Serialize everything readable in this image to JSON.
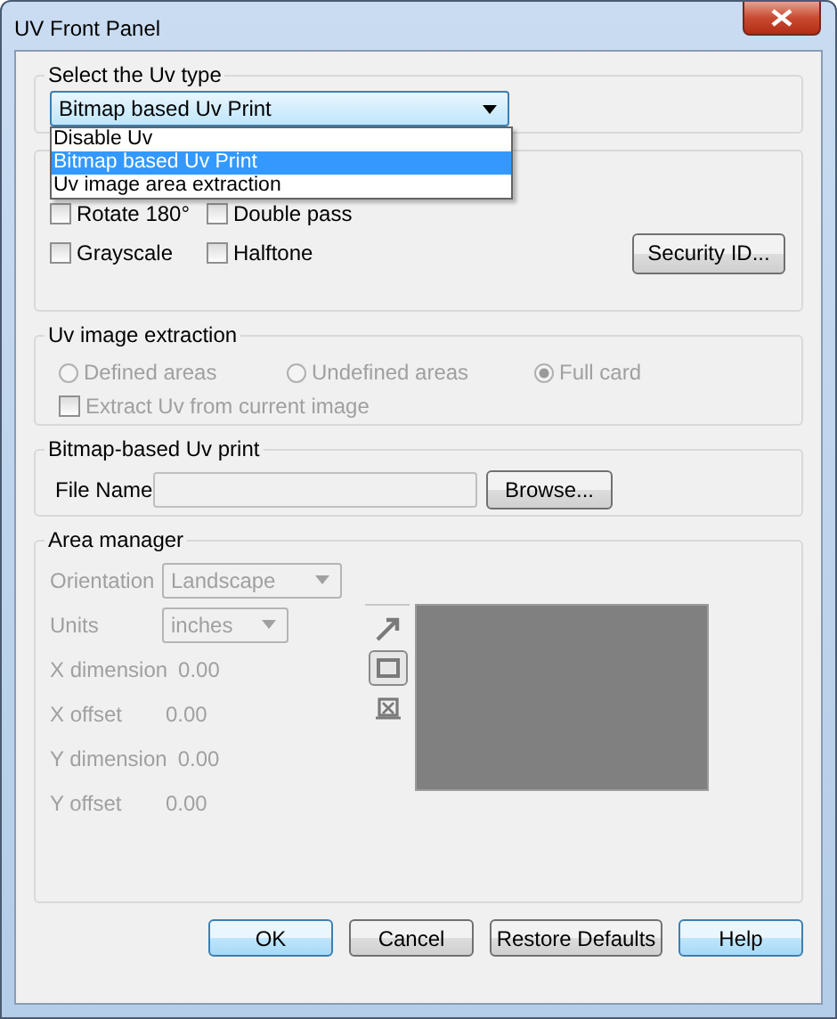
{
  "window": {
    "title": "UV Front Panel"
  },
  "uv_type": {
    "legend": "Select the Uv type",
    "value": "Bitmap based Uv Print",
    "expanded": true,
    "options": [
      {
        "label": "Disable Uv",
        "selected": false
      },
      {
        "label": "Bitmap based Uv Print",
        "selected": true
      },
      {
        "label": "Uv image area extraction",
        "selected": false
      }
    ]
  },
  "print_options": {
    "checkboxes": [
      {
        "label": "Rotate 180°",
        "checked": false
      },
      {
        "label": "Double pass",
        "checked": false
      },
      {
        "label": "Grayscale",
        "checked": false
      },
      {
        "label": "Halftone",
        "checked": false
      }
    ],
    "security_button": "Security ID..."
  },
  "extraction": {
    "legend": "Uv image extraction",
    "disabled": true,
    "radios": [
      {
        "label": "Defined areas",
        "selected": false
      },
      {
        "label": "Undefined areas",
        "selected": false
      },
      {
        "label": "Full card",
        "selected": true
      }
    ],
    "checkbox": {
      "label": "Extract Uv from current image",
      "checked": false
    }
  },
  "bitmap_print": {
    "legend": "Bitmap-based Uv print",
    "file_label": "File Name",
    "browse_button": "Browse..."
  },
  "area_manager": {
    "legend": "Area manager",
    "disabled": true,
    "orientation": {
      "label": "Orientation",
      "value": "Landscape"
    },
    "units": {
      "label": "Units",
      "value": "inches"
    },
    "fields": [
      {
        "label": "X dimension",
        "value": "0.00"
      },
      {
        "label": "X offset",
        "value": "0.00"
      },
      {
        "label": "Y dimension",
        "value": "0.00"
      },
      {
        "label": "Y offset",
        "value": "0.00"
      }
    ],
    "tools": [
      {
        "kind": "arrow",
        "selected": false
      },
      {
        "kind": "rectangle",
        "selected": true
      },
      {
        "kind": "delete",
        "selected": false
      }
    ]
  },
  "buttons": [
    {
      "label": "OK",
      "highlighted": true
    },
    {
      "label": "Cancel",
      "highlighted": false
    },
    {
      "label": "Restore Defaults",
      "highlighted": false
    },
    {
      "label": "Help",
      "highlighted": true
    }
  ]
}
